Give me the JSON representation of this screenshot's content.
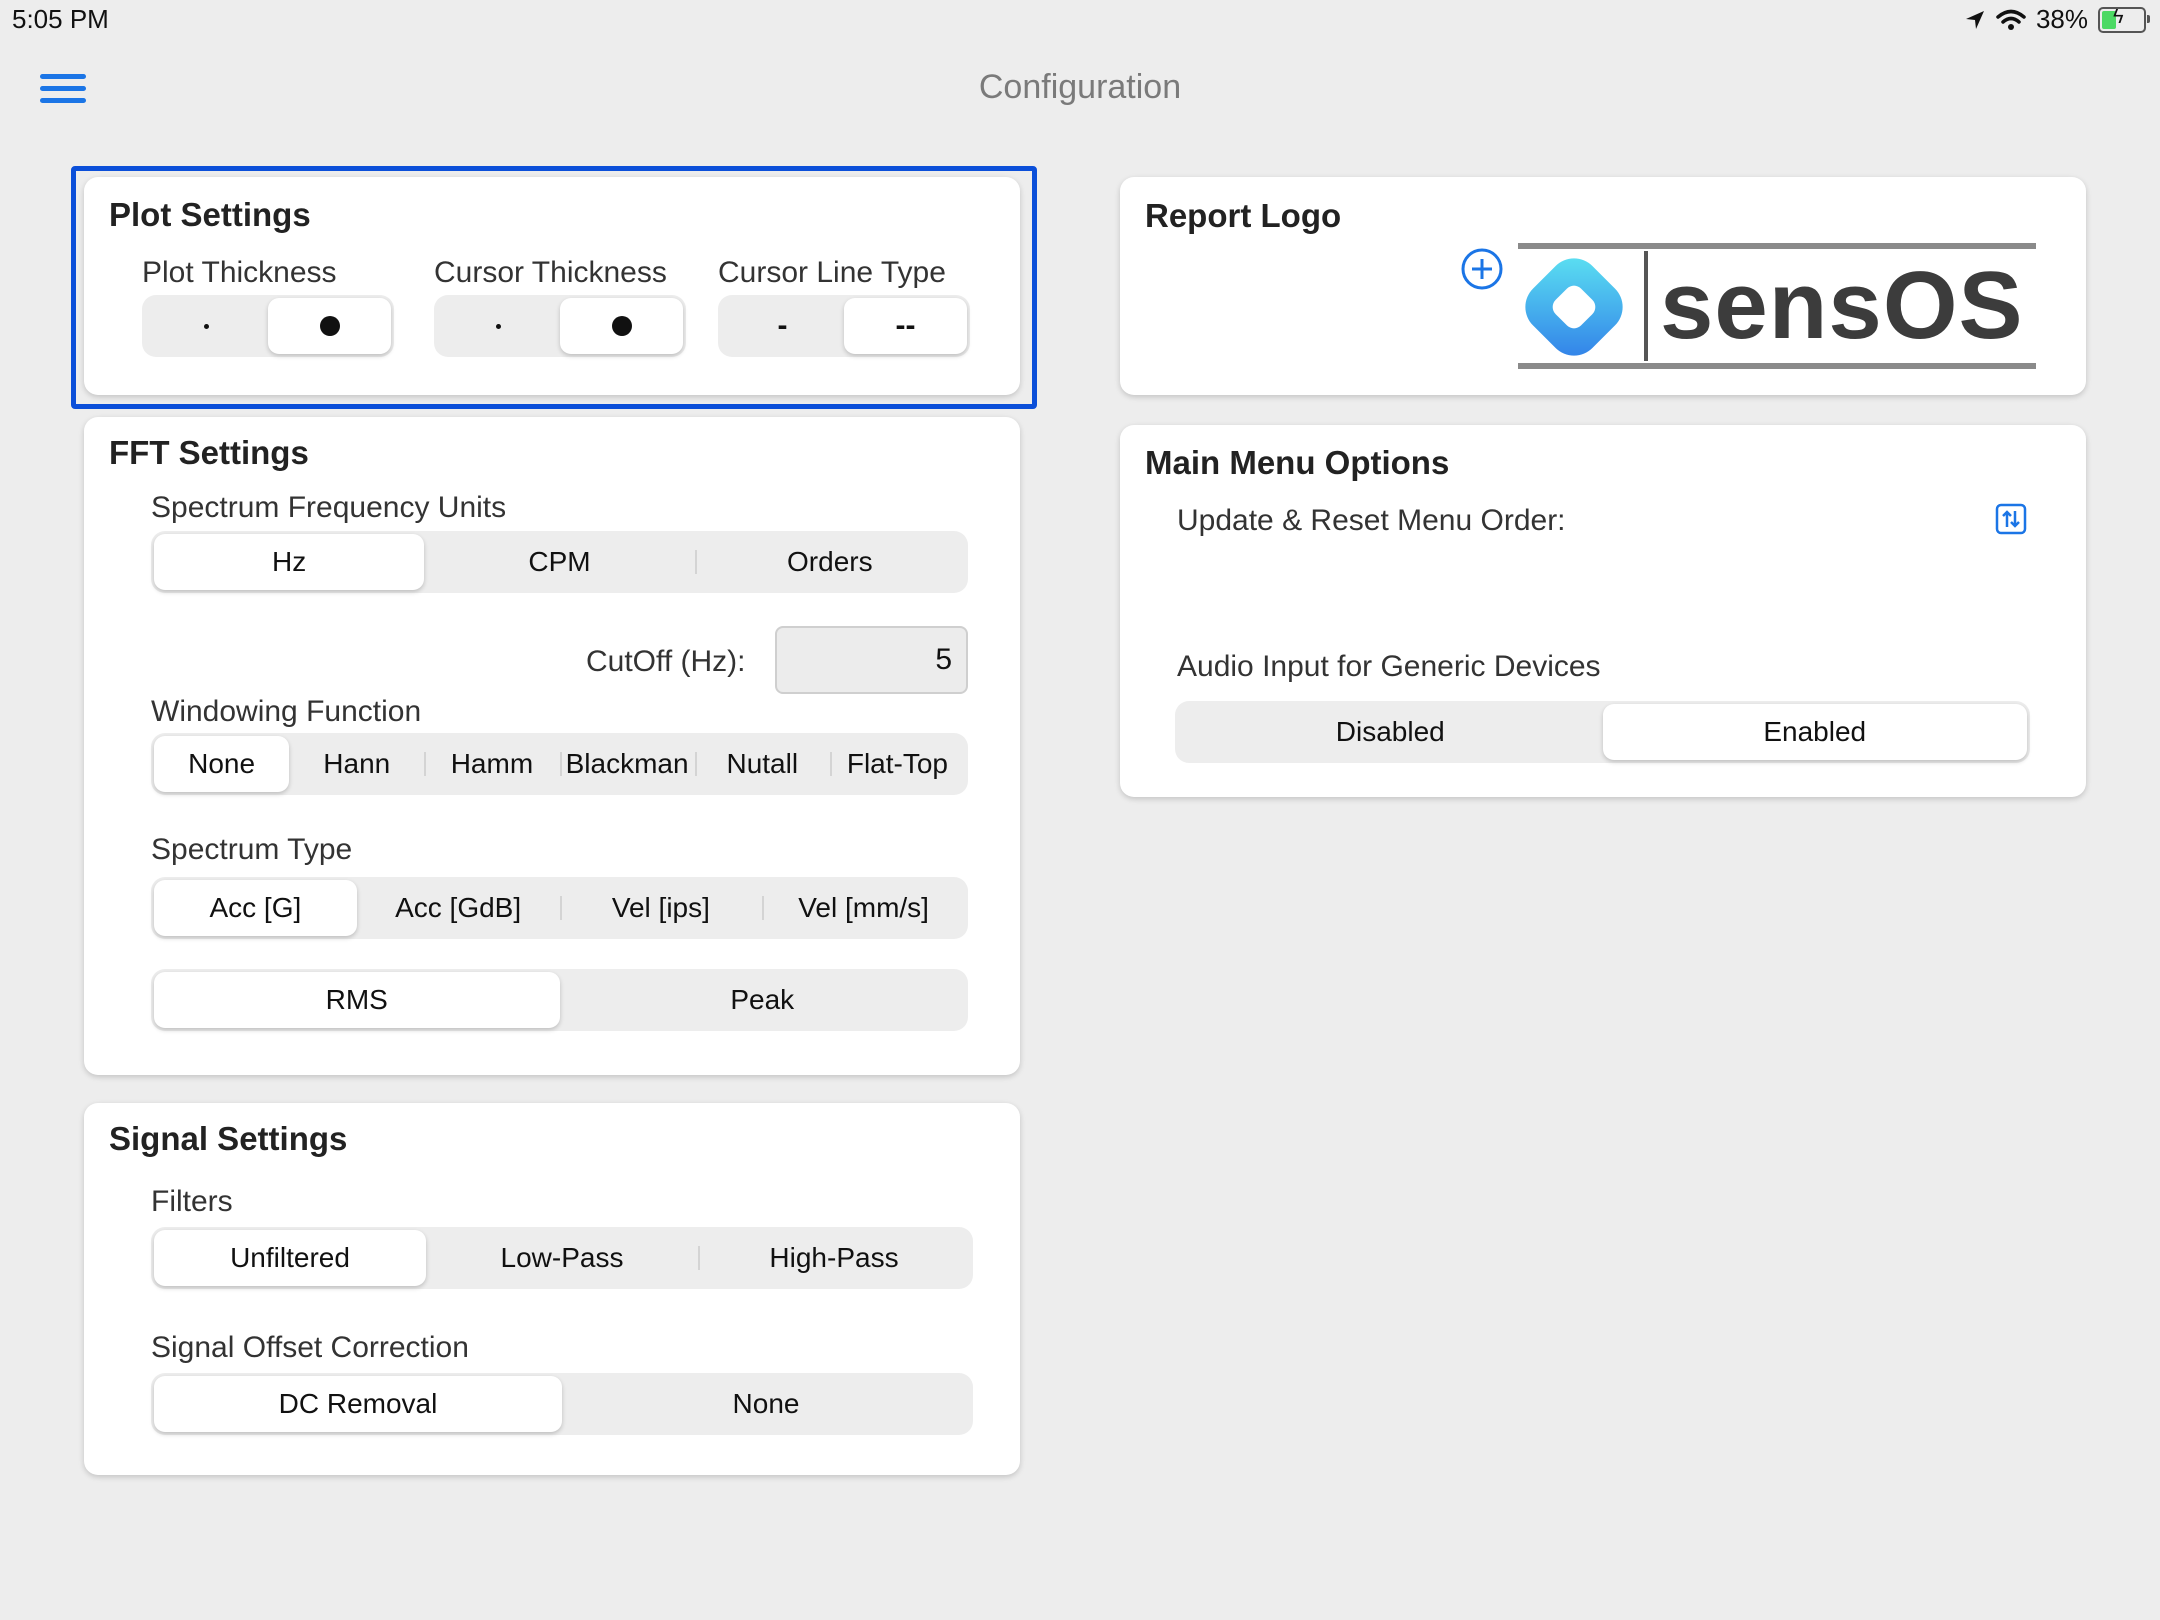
{
  "status_bar": {
    "time": "5:05 PM",
    "battery": "38%",
    "battery_level": 0.38
  },
  "nav": {
    "title": "Configuration"
  },
  "plot_settings": {
    "title": "Plot Settings",
    "plot_thickness": {
      "label": "Plot Thickness",
      "options": [
        "small-dot",
        "large-dot"
      ],
      "selected": 1
    },
    "cursor_thickness": {
      "label": "Cursor Thickness",
      "options": [
        "small-dot",
        "large-dot"
      ],
      "selected": 1
    },
    "cursor_line_type": {
      "label": "Cursor Line Type",
      "options": [
        "-",
        "--"
      ],
      "selected": 1
    }
  },
  "fft_settings": {
    "title": "FFT Settings",
    "spectrum_frequency_units": {
      "label": "Spectrum Frequency Units",
      "options": [
        "Hz",
        "CPM",
        "Orders"
      ],
      "selected": 0
    },
    "cutoff": {
      "label": "CutOff (Hz):",
      "value": "5"
    },
    "windowing_function": {
      "label": "Windowing Function",
      "options": [
        "None",
        "Hann",
        "Hamm",
        "Blackman",
        "Nutall",
        "Flat-Top"
      ],
      "selected": 0
    },
    "spectrum_type": {
      "label": "Spectrum Type",
      "options": [
        "Acc [G]",
        "Acc [GdB]",
        "Vel [ips]",
        "Vel [mm/s]"
      ],
      "selected": 0
    },
    "amplitude": {
      "options": [
        "RMS",
        "Peak"
      ],
      "selected": 0
    }
  },
  "signal_settings": {
    "title": "Signal Settings",
    "filters": {
      "label": "Filters",
      "options": [
        "Unfiltered",
        "Low-Pass",
        "High-Pass"
      ],
      "selected": 0
    },
    "offset_correction": {
      "label": "Signal Offset Correction",
      "options": [
        "DC Removal",
        "None"
      ],
      "selected": 0
    }
  },
  "report_logo": {
    "title": "Report Logo",
    "logo_text": "sensOS",
    "add_icon": "plus-circle-icon"
  },
  "main_menu_options": {
    "title": "Main Menu Options",
    "reorder_label": "Update & Reset Menu Order:",
    "reorder_icon": "reorder-icon",
    "audio_input": {
      "label": "Audio Input for Generic Devices",
      "options": [
        "Disabled",
        "Enabled"
      ],
      "selected": 1
    }
  },
  "colors": {
    "accent": "#1b75e6",
    "highlight": "#0b4fd9",
    "background": "#ededed"
  }
}
